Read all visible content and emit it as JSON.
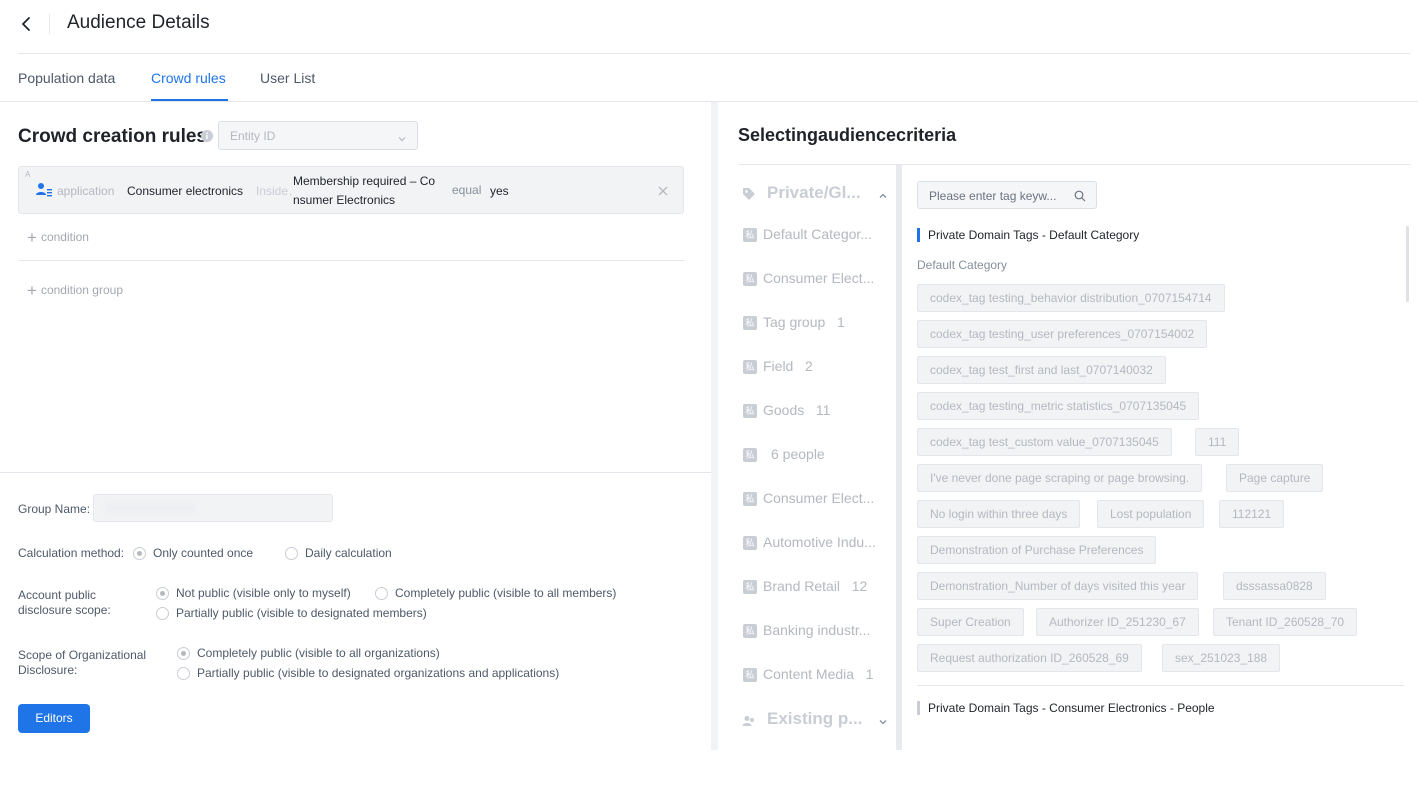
{
  "header": {
    "title": "Audience Details"
  },
  "tabs": [
    {
      "label": "Population data"
    },
    {
      "label": "Crowd rules"
    },
    {
      "label": "User List"
    }
  ],
  "rules": {
    "title": "Crowd creation rules",
    "entity_placeholder": "Entity ID",
    "condition": {
      "letter": "A",
      "source": "application",
      "app": "Consumer electronics",
      "scope": "Inside",
      "field_line1": "Membership required – Co",
      "field_line2": "nsumer Electronics",
      "operator": "equal",
      "value": "yes"
    },
    "add_condition": "condition",
    "add_condition_group": "condition group"
  },
  "form": {
    "group_name_label": "Group Name:",
    "calc_label": "Calculation method:",
    "calc_options": [
      "Only counted once",
      "Daily calculation"
    ],
    "account_label": "Account public disclosure scope:",
    "account_options": [
      "Not public (visible only to myself)",
      "Completely public (visible to all members)",
      "Partially public (visible to designated members)"
    ],
    "org_label": "Scope of Organizational Disclosure:",
    "org_options": [
      "Completely public (visible to all organizations)",
      "Partially public (visible to designated organizations and applications)"
    ],
    "submit": "Editors"
  },
  "criteria": {
    "title": "Selectingaudiencecriteria",
    "groups": [
      {
        "name": "Private/Gl..."
      },
      {
        "name": "Existing p..."
      }
    ],
    "categories": [
      {
        "badge": "私",
        "name": "Default Categor..."
      },
      {
        "badge": "私",
        "name": "Consumer Elect..."
      },
      {
        "badge": "私",
        "name": "Tag group",
        "count": "1"
      },
      {
        "badge": "私",
        "name": "Field",
        "count": "2"
      },
      {
        "badge": "私",
        "name": "Goods",
        "count": "11"
      },
      {
        "badge": "私",
        "name": "6 people"
      },
      {
        "badge": "私",
        "name": "Consumer Elect..."
      },
      {
        "badge": "私",
        "name": "Automotive Indu..."
      },
      {
        "badge": "私",
        "name": "Brand Retail",
        "count": "12"
      },
      {
        "badge": "私",
        "name": "Banking industr..."
      },
      {
        "badge": "私",
        "name": "Content Media",
        "count": "1"
      }
    ],
    "search_placeholder": "Please enter tag keyw...",
    "section1": "Private Domain Tags - Default Category",
    "subcategory": "Default Category",
    "tags": [
      "codex_tag testing_behavior distribution_0707154714",
      "codex_tag testing_user preferences_0707154002",
      "codex_tag test_first and last_0707140032",
      "codex_tag testing_metric statistics_0707135045",
      "codex_tag test_custom value_0707135045",
      "111",
      "I've never done page scraping or page browsing.",
      "Page capture",
      "No login within three days",
      "Lost population",
      "112121",
      "Demonstration of Purchase Preferences",
      "Demonstration_Number of days visited this year",
      "dsssassa0828",
      "Super Creation",
      "Authorizer ID_251230_67",
      "Tenant ID_260528_70",
      "Request authorization ID_260528_69",
      "sex_251023_188"
    ],
    "section2": "Private Domain Tags - Consumer Electronics - People"
  }
}
